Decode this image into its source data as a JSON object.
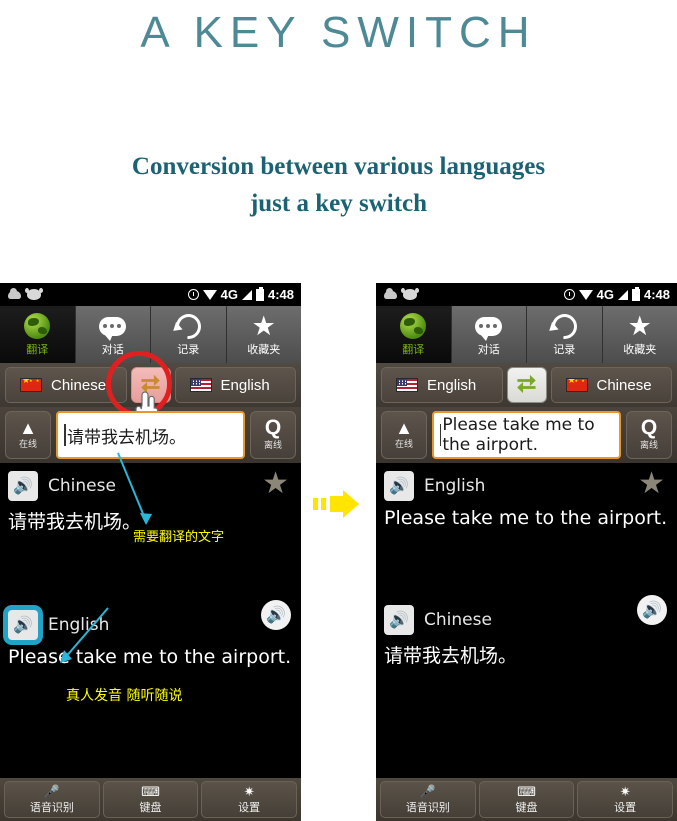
{
  "header": {
    "title": "A KEY SWITCH",
    "subtitle_line1": "Conversion between various languages",
    "subtitle_line2": "just a key switch",
    "title_color": "#4e8a96",
    "subtitle_color": "#1b6272"
  },
  "status_bar": {
    "time": "4:48",
    "network": "4G",
    "icons": [
      "cloud-icon",
      "mask-icon",
      "alarm-icon",
      "wifi-icon",
      "signal-icon",
      "battery-icon"
    ]
  },
  "tabs": [
    {
      "label": "翻译",
      "icon": "globe-icon",
      "active": true
    },
    {
      "label": "对话",
      "icon": "speech-bubble-icon",
      "active": false
    },
    {
      "label": "记录",
      "icon": "history-icon",
      "active": false
    },
    {
      "label": "收藏夹",
      "icon": "star-icon",
      "active": false
    }
  ],
  "left_phone": {
    "source_language": "Chinese",
    "source_flag": "flag-cn",
    "target_language": "English",
    "target_flag": "flag-us",
    "swap_button_icon": "swap-arrows-icon",
    "swap_button_state": "tapped",
    "online_label": "在线",
    "offline_label": "离线",
    "input_value": "请带我去机场。",
    "result_top": {
      "language": "Chinese",
      "text": "请带我去机场。"
    },
    "result_bottom": {
      "language": "English",
      "text": "Please take me to the airport."
    },
    "annotation_input": "需要翻译的文字",
    "annotation_speech": "真人发音 随听随说"
  },
  "right_phone": {
    "source_language": "English",
    "source_flag": "flag-us",
    "target_language": "Chinese",
    "target_flag": "flag-cn",
    "swap_button_icon": "swap-arrows-icon",
    "swap_button_state": "normal",
    "online_label": "在线",
    "offline_label": "离线",
    "input_value": "Please take me to the airport.",
    "result_top": {
      "language": "English",
      "text": "Please take me to the airport."
    },
    "result_bottom": {
      "language": "Chinese",
      "text": "请带我去机场。"
    }
  },
  "bottom_bar": [
    {
      "label": "语音识别",
      "icon": "microphone-icon"
    },
    {
      "label": "键盘",
      "icon": "keyboard-icon"
    },
    {
      "label": "设置",
      "icon": "gear-icon"
    }
  ],
  "colors": {
    "accent_orange": "#e8962e",
    "swap_green": "#79a82b",
    "swap_amber": "#c98a32",
    "highlight_red": "#e02020",
    "annotation_yellow": "#ffff00",
    "arrow_cyan": "#29b6d8",
    "transition_arrow": "#ffe400"
  }
}
